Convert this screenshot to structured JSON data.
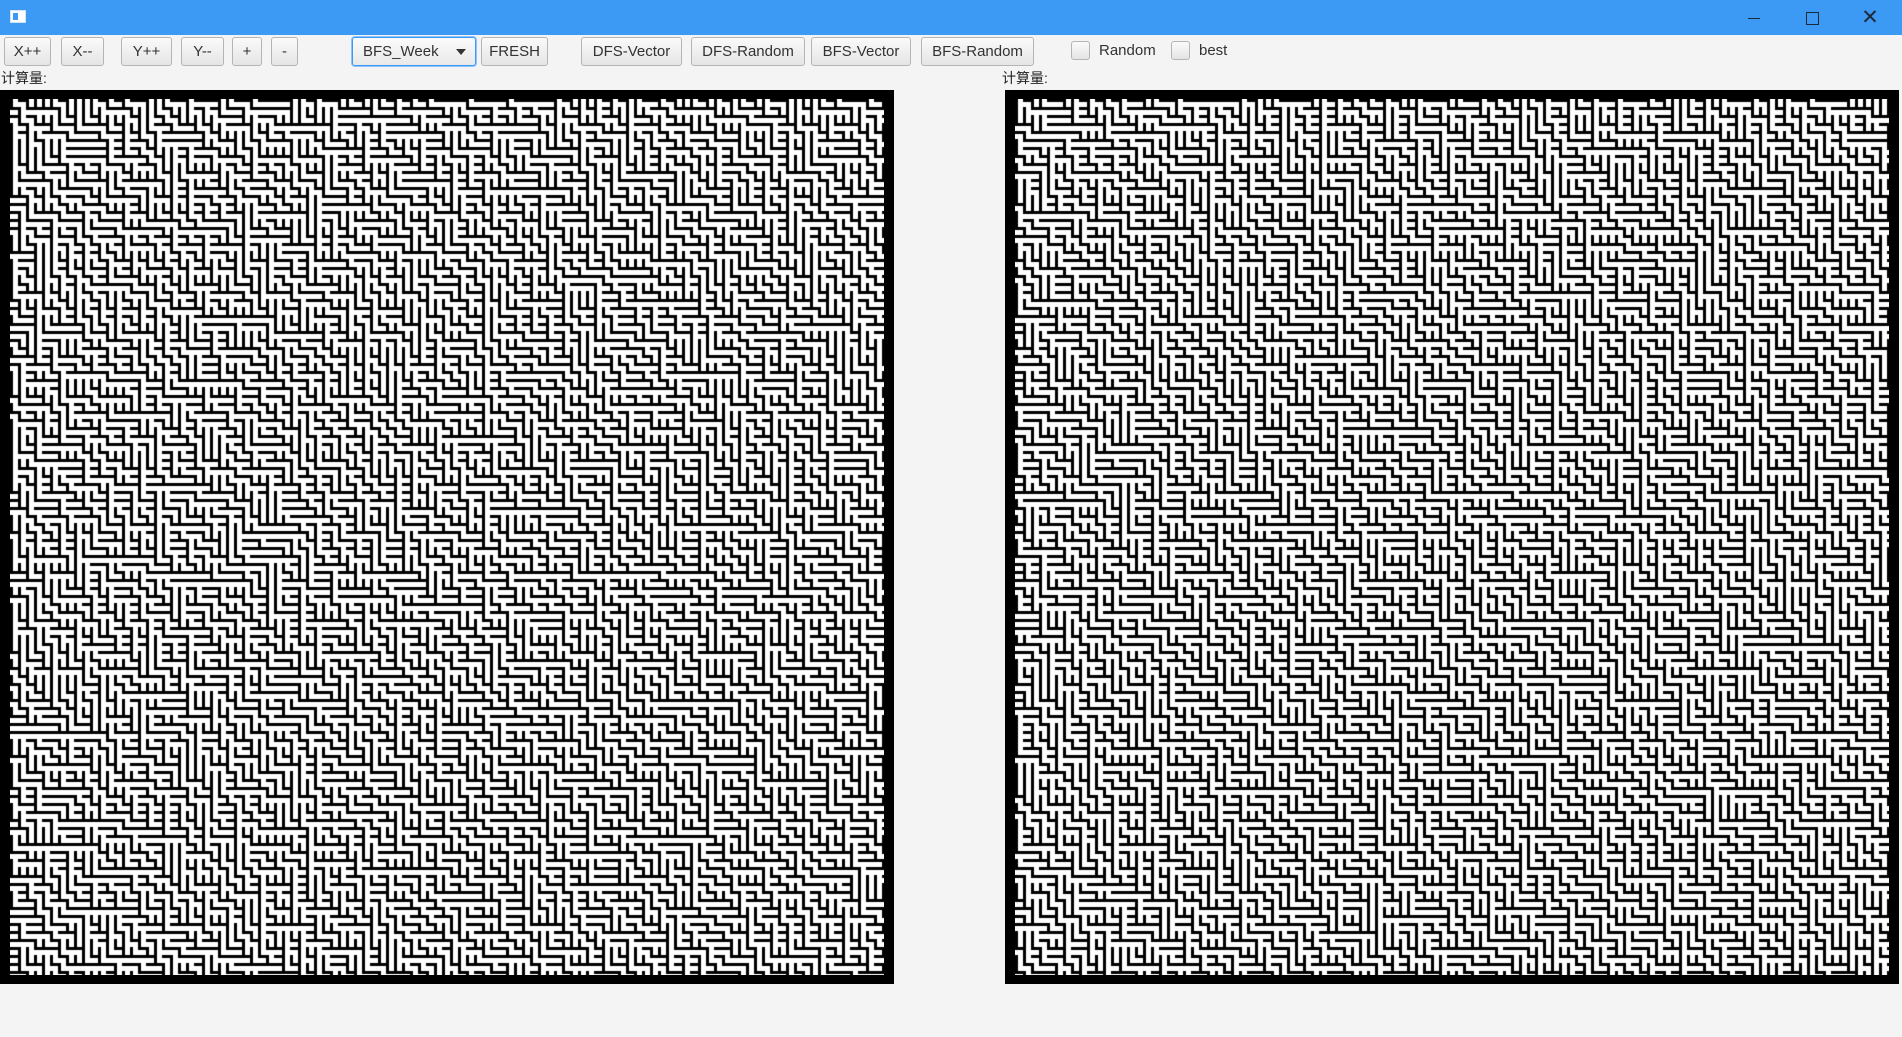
{
  "titlebar": {
    "app_icon": "window-icon",
    "minimize_icon": "minimize-icon",
    "maximize_icon": "maximize-icon",
    "close_icon": "close-icon",
    "color": "#3c9af5"
  },
  "toolbar": {
    "buttons": {
      "x_inc": "X++",
      "x_dec": "X--",
      "y_inc": "Y++",
      "y_dec": "Y--",
      "plus": "+",
      "minus": "-",
      "fresh": "FRESH",
      "dfs_vector": "DFS-Vector",
      "dfs_random": "DFS-Random",
      "bfs_vector": "BFS-Vector",
      "bfs_random": "BFS-Random"
    },
    "algorithm_select": {
      "selected": "BFS_Week"
    },
    "checkboxes": {
      "random": {
        "label": "Random",
        "checked": false
      },
      "best": {
        "label": "best",
        "checked": false
      }
    }
  },
  "left_panel": {
    "calc_label": "计算量:"
  },
  "right_panel": {
    "calc_label": "计算量:"
  },
  "colors": {
    "wall": "#000000",
    "path": "#ffffff",
    "background": "#f4f4f4"
  }
}
